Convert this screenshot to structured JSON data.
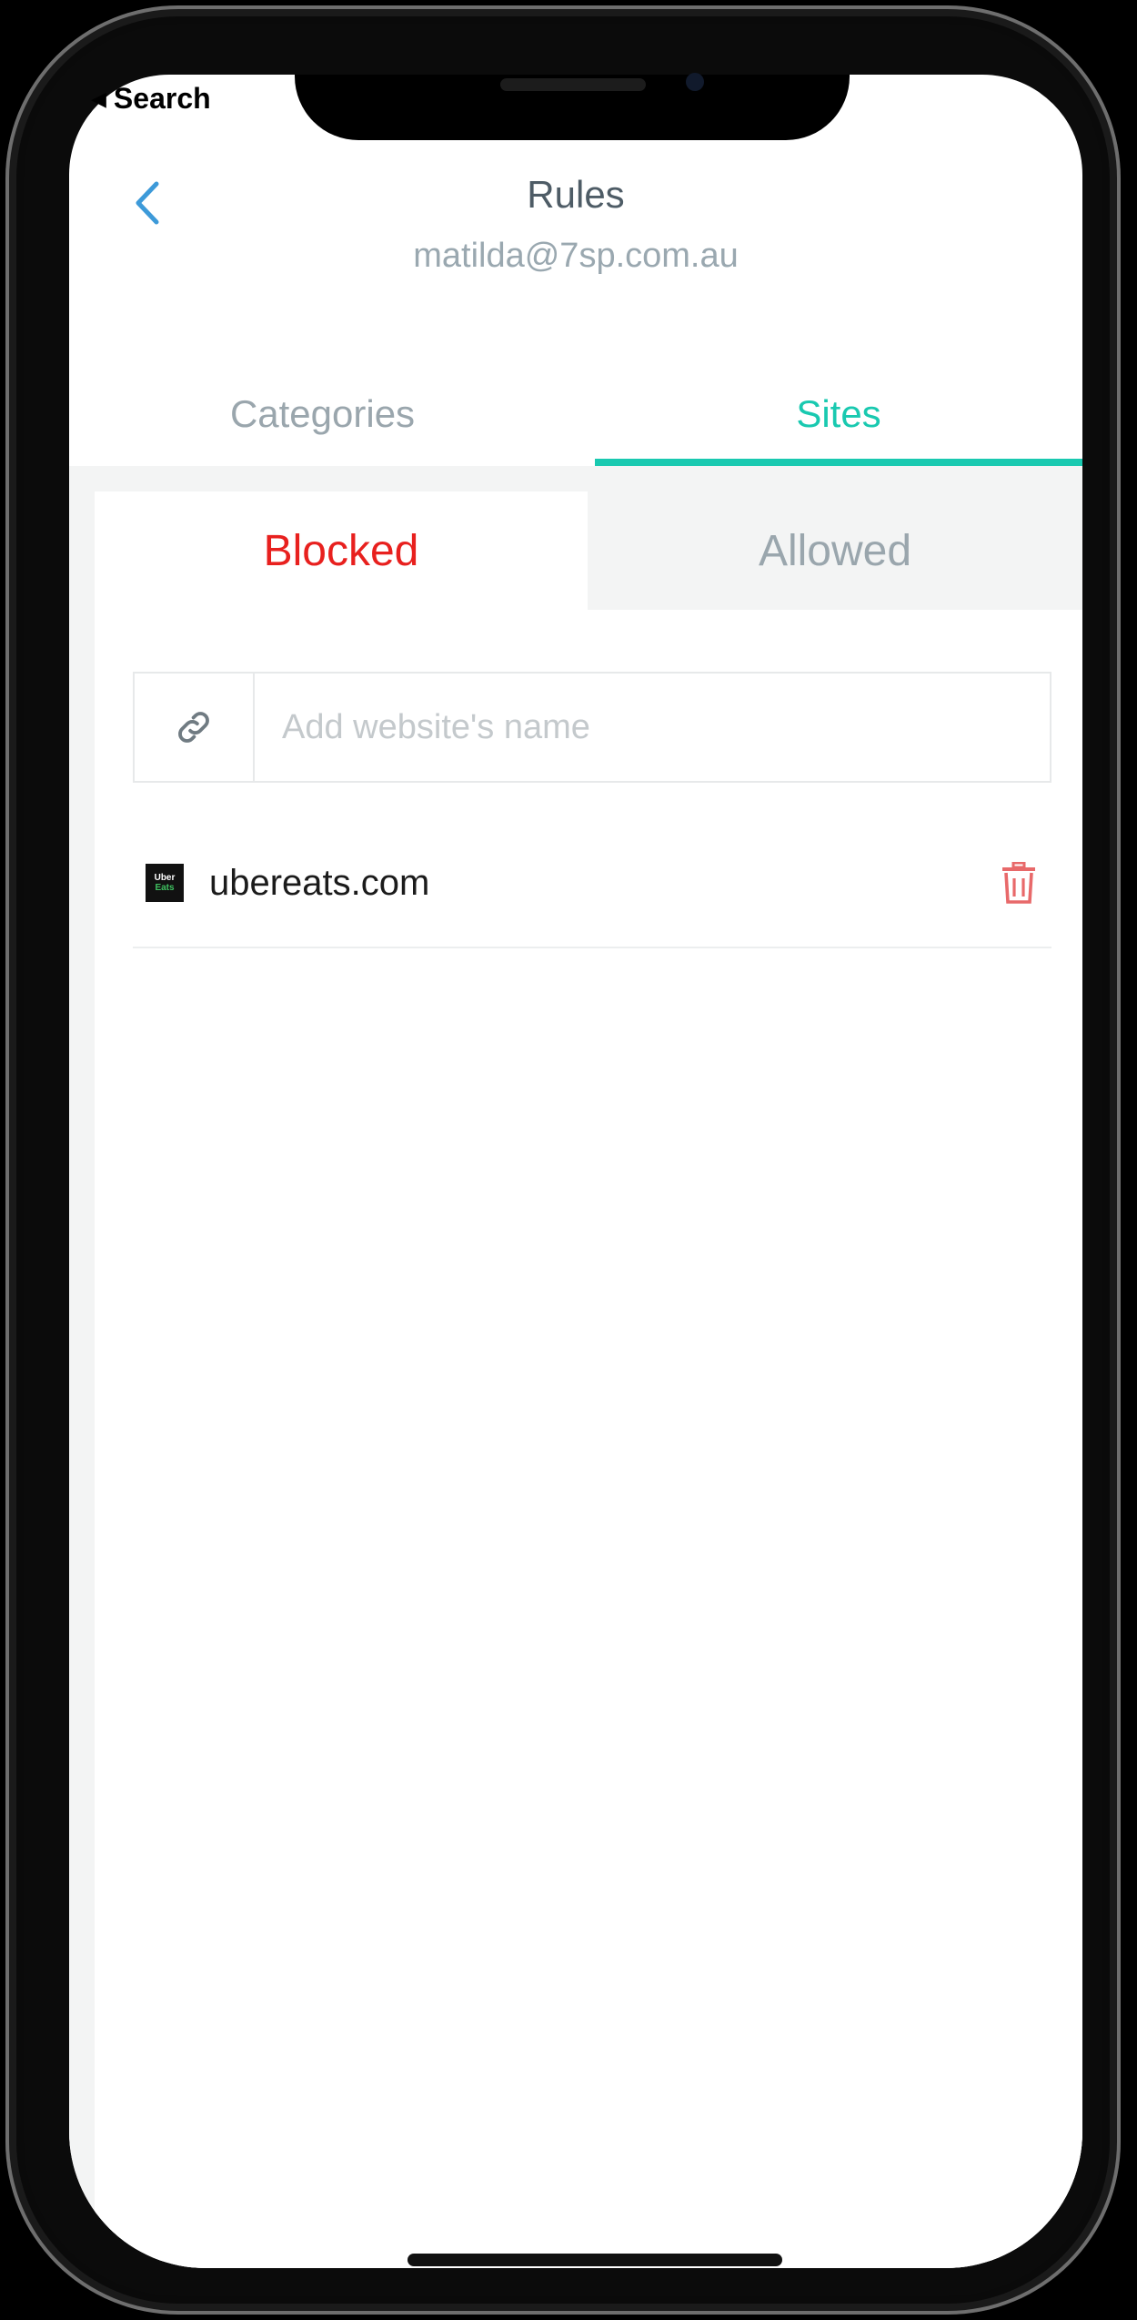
{
  "status_bar": {
    "back_app_label": "Search"
  },
  "header": {
    "title": "Rules",
    "subtitle": "matilda@7sp.com.au"
  },
  "tabs": [
    {
      "label": "Categories",
      "active": false
    },
    {
      "label": "Sites",
      "active": true
    }
  ],
  "segments": [
    {
      "label": "Blocked",
      "active": true
    },
    {
      "label": "Allowed",
      "active": false
    }
  ],
  "add_site": {
    "placeholder": "Add website's name",
    "value": ""
  },
  "sites": [
    {
      "name": "ubereats.com",
      "favicon_text_top": "Uber",
      "favicon_text_bottom": "Eats"
    }
  ],
  "colors": {
    "accent": "#19c9b0",
    "blocked": "#e8201e",
    "back_arrow": "#3d9ad9",
    "trash": "#e8696a"
  },
  "icons": [
    "back-chevron-icon",
    "link-icon",
    "trash-icon"
  ]
}
